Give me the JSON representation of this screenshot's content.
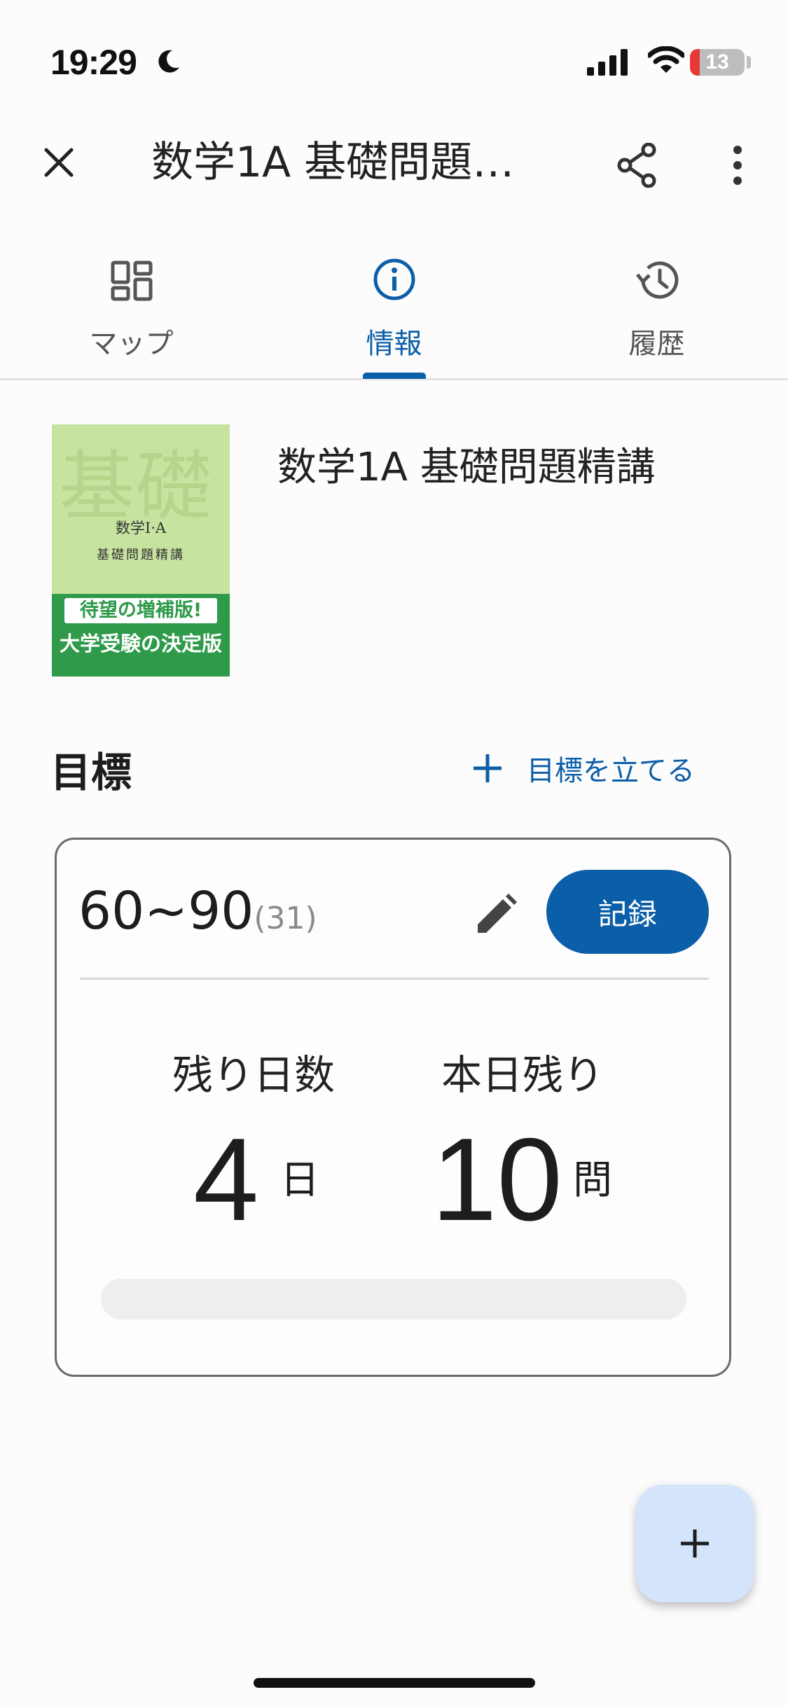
{
  "status_bar": {
    "time": "19:29",
    "battery": "13",
    "icons": [
      "moon-icon",
      "signal-icon",
      "wifi-icon",
      "battery-icon"
    ]
  },
  "header": {
    "title": "数学1A 基礎問題…",
    "icons": [
      "close-icon",
      "share-icon",
      "more-vert-icon"
    ]
  },
  "tabs": [
    {
      "label": "マップ",
      "icon": "grid-icon",
      "active": false
    },
    {
      "label": "情報",
      "icon": "info-icon",
      "active": true
    },
    {
      "label": "履歴",
      "icon": "history-icon",
      "active": false
    }
  ],
  "book": {
    "title": "数学1A 基礎問題精講",
    "cover": {
      "big_text": "基礎",
      "line1": "数学Ⅰ·A",
      "line2": "基礎問題精講",
      "banner1": "待望の増補版!",
      "banner2": "大学受験の決定版"
    }
  },
  "goal": {
    "heading": "目標",
    "set_goal_label": "目標を立てる",
    "range": "60~90",
    "range_count": "(31)",
    "record_label": "記録",
    "days_left_label": "残り日数",
    "days_left_value": "4",
    "days_unit": "日",
    "today_left_label": "本日残り",
    "today_left_value": "10",
    "today_unit": "問",
    "progress": 0
  },
  "colors": {
    "accent": "#0b5ea8",
    "fab_bg": "#d3e4fb",
    "cover_green": "#2e9a4a"
  }
}
